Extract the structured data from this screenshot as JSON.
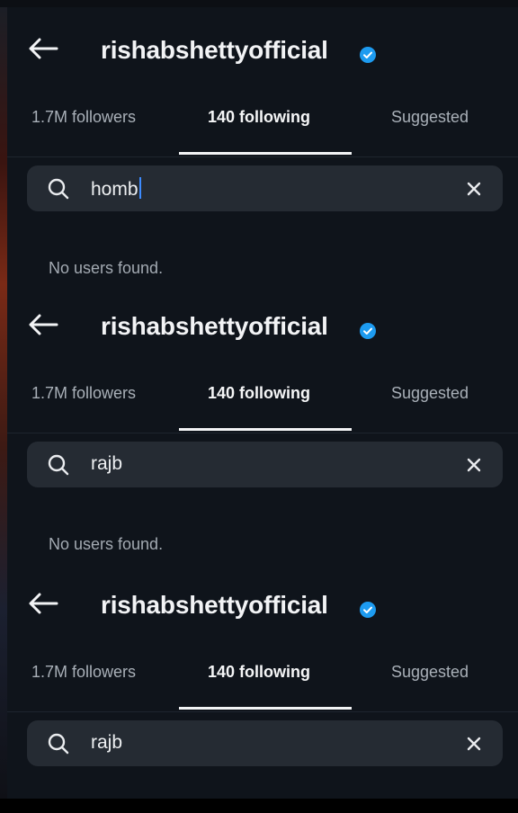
{
  "profile": {
    "username": "rishabshettyofficial",
    "verified_color": "#1d9bf0"
  },
  "tabs": [
    "1.7M followers",
    "140 following",
    "Suggested"
  ],
  "active_tab": "140 following",
  "panels": [
    {
      "search_query": "homb",
      "empty_message": "No users found."
    },
    {
      "search_query": "rajb",
      "empty_message": "No users found."
    },
    {
      "search_query": "rajb"
    }
  ],
  "icons": {
    "back": "arrow-left-icon",
    "verified": "verified-badge-icon",
    "search": "search-icon",
    "clear": "close-icon"
  },
  "colors": {
    "background": "#0f141b",
    "search_field": "#252b33",
    "text_primary": "#f2f3f5",
    "text_secondary": "#a9b0b8",
    "caret": "#3d8bff"
  }
}
